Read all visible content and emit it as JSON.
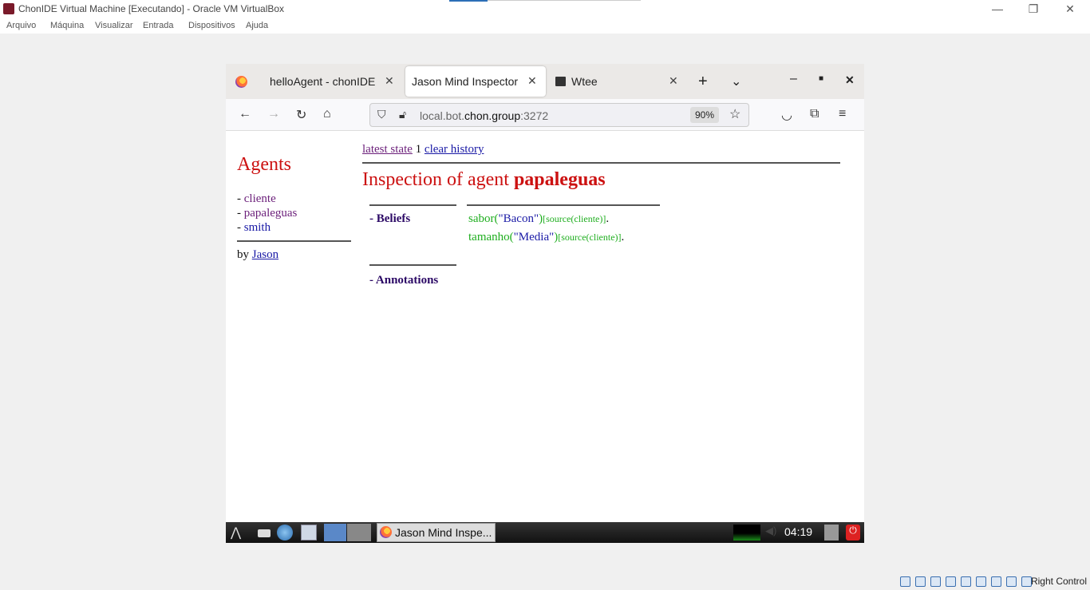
{
  "window": {
    "title": "ChonIDE Virtual Machine [Executando] - Oracle VM VirtualBox",
    "minimize": "—",
    "restore": "❐",
    "close": "✕"
  },
  "vb_menu": [
    "Arquivo",
    "Máquina",
    "Visualizar",
    "Entrada",
    "Dispositivos",
    "Ajuda"
  ],
  "browser": {
    "tabs": [
      {
        "label": "helloAgent - chonIDE",
        "active": false
      },
      {
        "label": "Jason Mind Inspector",
        "active": true
      },
      {
        "label": "Wtee",
        "active": false
      }
    ],
    "url_prefix": "local.bot.",
    "url_host": "chon.group",
    "url_suffix": ":3272",
    "zoom": "90%"
  },
  "page": {
    "agents_title": "Agents",
    "agents": [
      {
        "prefix": "- ",
        "name": "cliente",
        "color": "#6b1f7a"
      },
      {
        "prefix": "- ",
        "name": "papaleguas",
        "color": "#6b1f7a"
      },
      {
        "prefix": "- ",
        "name": "smith",
        "color": "#1a1aa6"
      }
    ],
    "by_label": "by ",
    "by_link": "Jason",
    "latest_state": "latest state",
    "history_count": "1",
    "clear_history": "clear history",
    "inspection_prefix": "Inspection of agent ",
    "agent_name": "papaleguas",
    "beliefs_label": "- Beliefs",
    "annotations_label": "- Annotations",
    "beliefs": [
      {
        "functor": "sabor(",
        "arg": "\"Bacon\"",
        "close": ")",
        "annotation": "[source(cliente)]",
        "end": "."
      },
      {
        "functor": "tamanho(",
        "arg": "\"Media\"",
        "close": ")",
        "annotation": "[source(cliente)]",
        "end": "."
      }
    ]
  },
  "taskbar": {
    "task_label": "Jason Mind Inspe...",
    "clock": "04:19"
  },
  "vb_status": {
    "host_key": "Right Control"
  }
}
